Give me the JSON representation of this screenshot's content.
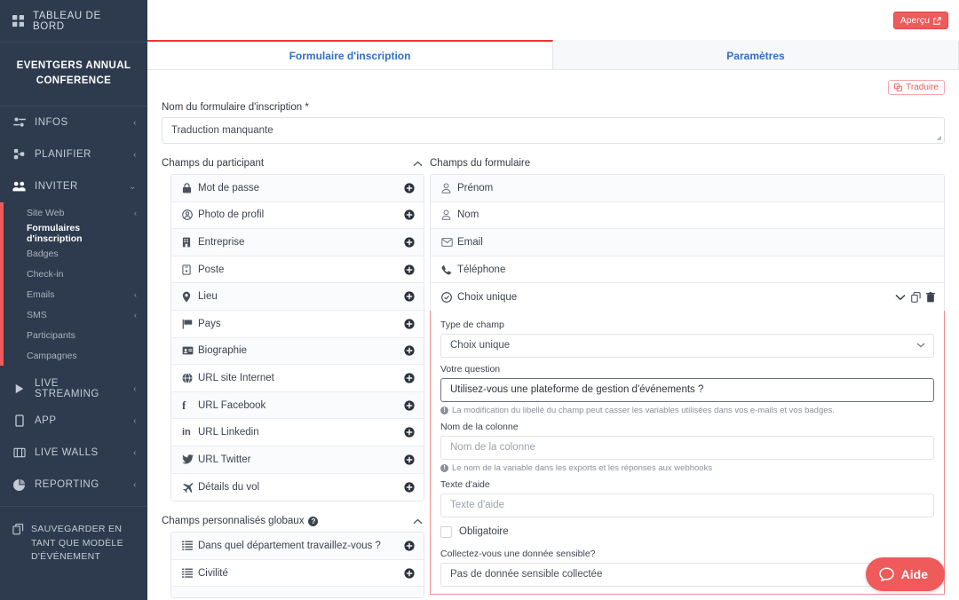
{
  "sidebar": {
    "dashboard": "TABLEAU DE BORD",
    "event_name": "EVENTGERS ANNUAL CONFERENCE",
    "items": [
      {
        "label": "INFOS",
        "icon": "sliders-icon",
        "chevron": "‹"
      },
      {
        "label": "PLANIFIER",
        "icon": "sitemap-icon",
        "chevron": "‹"
      },
      {
        "label": "INVITER",
        "icon": "users-icon",
        "chevron": "⌄"
      }
    ],
    "sub_items": [
      {
        "label": "Site Web",
        "chevron": "‹",
        "current": false
      },
      {
        "label": "Formulaires d'inscription",
        "chevron": "",
        "current": true
      },
      {
        "label": "Badges",
        "chevron": "",
        "current": false
      },
      {
        "label": "Check-in",
        "chevron": "",
        "current": false
      },
      {
        "label": "Emails",
        "chevron": "‹",
        "current": false
      },
      {
        "label": "SMS",
        "chevron": "‹",
        "current": false
      },
      {
        "label": "Participants",
        "chevron": "",
        "current": false
      },
      {
        "label": "Campagnes",
        "chevron": "",
        "current": false
      }
    ],
    "items_bottom": [
      {
        "label": "LIVE STREAMING",
        "icon": "play-icon",
        "chevron": "‹"
      },
      {
        "label": "APP",
        "icon": "mobile-icon",
        "chevron": "‹"
      },
      {
        "label": "LIVE WALLS",
        "icon": "tv-icon",
        "chevron": "‹"
      },
      {
        "label": "REPORTING",
        "icon": "pie-chart-icon",
        "chevron": "‹"
      }
    ],
    "save_template": "SAUVEGARDER EN TANT QUE MODÈLE D'ÉVÉNEMENT",
    "accent_color": "#ef5a5a",
    "background_color": "#2e3b4e"
  },
  "topbar": {
    "preview_label": "Aperçu"
  },
  "tabs": [
    {
      "label": "Formulaire d'inscription",
      "active": true
    },
    {
      "label": "Paramètres",
      "active": false
    }
  ],
  "form_header": {
    "translate_label": "Traduire",
    "name_label": "Nom du formulaire d'inscription *",
    "name_value": "Traduction manquante"
  },
  "participant_section": {
    "title": "Champs du participant",
    "fields": [
      {
        "label": "Mot de passe",
        "icon": "lock-icon"
      },
      {
        "label": "Photo de profil",
        "icon": "user-circle-icon"
      },
      {
        "label": "Entreprise",
        "icon": "building-icon"
      },
      {
        "label": "Poste",
        "icon": "id-badge-icon"
      },
      {
        "label": "Lieu",
        "icon": "map-pin-icon"
      },
      {
        "label": "Pays",
        "icon": "flag-icon"
      },
      {
        "label": "Biographie",
        "icon": "id-card-icon"
      },
      {
        "label": "URL site Internet",
        "icon": "globe-icon"
      },
      {
        "label": "URL Facebook",
        "icon": "facebook-icon"
      },
      {
        "label": "URL Linkedin",
        "icon": "linkedin-icon"
      },
      {
        "label": "URL Twitter",
        "icon": "twitter-icon"
      },
      {
        "label": "Détails du vol",
        "icon": "plane-icon"
      }
    ]
  },
  "custom_section": {
    "title": "Champs personnalisés globaux",
    "fields": [
      {
        "label": "Dans quel département travaillez-vous ?",
        "icon": "list-icon"
      },
      {
        "label": "Civilité",
        "icon": "list-icon"
      }
    ]
  },
  "form_section": {
    "title": "Champs du formulaire",
    "fields": [
      {
        "label": "Prénom",
        "icon": "user-icon",
        "expanded": false
      },
      {
        "label": "Nom",
        "icon": "user-icon",
        "expanded": false
      },
      {
        "label": "Email",
        "icon": "envelope-icon",
        "expanded": false
      },
      {
        "label": "Téléphone",
        "icon": "phone-icon",
        "expanded": false
      },
      {
        "label": "Choix unique",
        "icon": "check-circle-icon",
        "expanded": true
      }
    ]
  },
  "field_config": {
    "type_label": "Type de champ",
    "type_value": "Choix unique",
    "question_label": "Votre question",
    "question_value": "Utilisez-vous une plateforme de gestion d'événements ?",
    "question_hint": "La modification du libellé du champ peut casser les variables utilisées dans vos e-mails et vos badges.",
    "column_label": "Nom de la colonne",
    "column_placeholder": "Nom de la colonne",
    "column_hint": "Le nom de la variable dans les exports et les réponses aux webhooks",
    "help_text_label": "Texte d'aide",
    "help_text_placeholder": "Texte d'aide",
    "required_label": "Obligatoire",
    "required_checked": false,
    "sensitive_label": "Collectez-vous une donnée sensible?",
    "sensitive_value": "Pas de donnée sensible collectée"
  },
  "help_widget": {
    "label": "Aide",
    "color": "#ef5a5a"
  }
}
